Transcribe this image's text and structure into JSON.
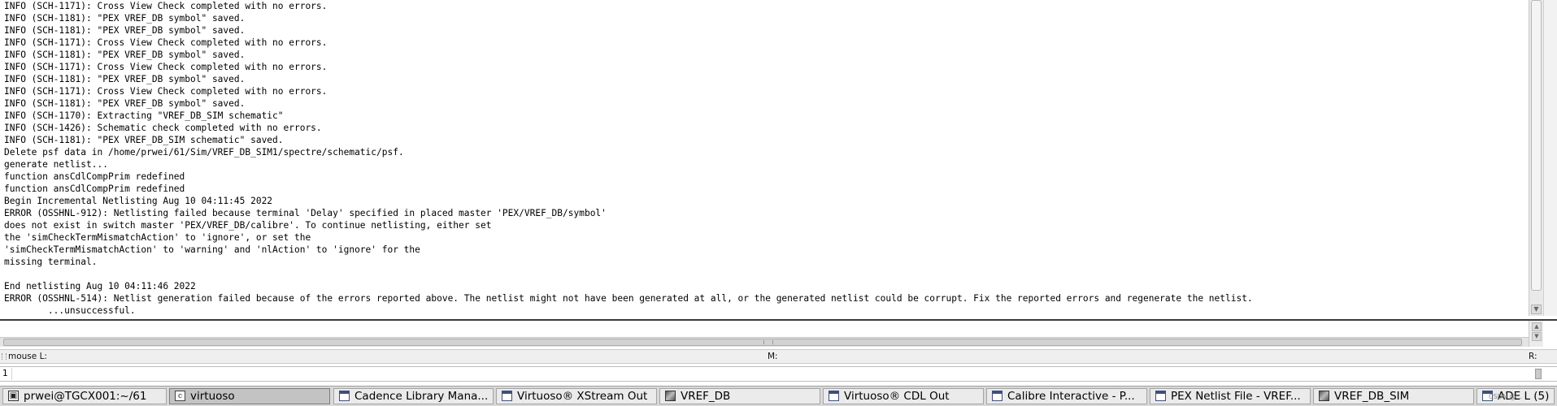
{
  "log": {
    "lines": [
      "INFO (SCH-1171): Cross View Check completed with no errors.",
      "INFO (SCH-1181): \"PEX VREF_DB symbol\" saved.",
      "INFO (SCH-1181): \"PEX VREF_DB symbol\" saved.",
      "INFO (SCH-1171): Cross View Check completed with no errors.",
      "INFO (SCH-1181): \"PEX VREF_DB symbol\" saved.",
      "INFO (SCH-1171): Cross View Check completed with no errors.",
      "INFO (SCH-1181): \"PEX VREF_DB symbol\" saved.",
      "INFO (SCH-1171): Cross View Check completed with no errors.",
      "INFO (SCH-1181): \"PEX VREF_DB symbol\" saved.",
      "INFO (SCH-1170): Extracting \"VREF_DB_SIM schematic\"",
      "INFO (SCH-1426): Schematic check completed with no errors.",
      "INFO (SCH-1181): \"PEX VREF_DB_SIM schematic\" saved.",
      "Delete psf data in /home/prwei/61/Sim/VREF_DB_SIM1/spectre/schematic/psf.",
      "generate netlist...",
      "function ansCdlCompPrim redefined",
      "function ansCdlCompPrim redefined",
      "Begin Incremental Netlisting Aug 10 04:11:45 2022",
      "ERROR (OSSHNL-912): Netlisting failed because terminal 'Delay' specified in placed master 'PEX/VREF_DB/symbol'",
      "does not exist in switch master 'PEX/VREF_DB/calibre'. To continue netlisting, either set",
      "the 'simCheckTermMismatchAction' to 'ignore', or set the",
      "'simCheckTermMismatchAction' to 'warning' and 'nlAction' to 'ignore' for the",
      "missing terminal.",
      "",
      "End netlisting Aug 10 04:11:46 2022",
      "ERROR (OSSHNL-514): Netlist generation failed because of the errors reported above. The netlist might not have been generated at all, or the generated netlist could be corrupt. Fix the reported errors and regenerate the netlist.",
      "        ...unsuccessful."
    ]
  },
  "status": {
    "mouse_left": "mouse L:",
    "mouse_middle": "M:",
    "mouse_right": "R:"
  },
  "prompt": {
    "number": "1",
    "value": ""
  },
  "taskbar": {
    "items": [
      {
        "label": "prwei@TGCX001:~/61",
        "icon": "terminal-icon"
      },
      {
        "label": "virtuoso",
        "icon": "virtuoso-icon"
      },
      {
        "label": "Cadence Library Mana...",
        "icon": "window-icon"
      },
      {
        "label": "Virtuoso® XStream Out",
        "icon": "window-icon"
      },
      {
        "label": "VREF_DB",
        "icon": "layout-icon"
      },
      {
        "label": "Virtuoso® CDL Out",
        "icon": "window-icon"
      },
      {
        "label": "Calibre Interactive - P...",
        "icon": "window-icon"
      },
      {
        "label": "PEX Netlist File - VREF...",
        "icon": "window-icon"
      },
      {
        "label": "VREF_DB_SIM",
        "icon": "layout-icon"
      },
      {
        "label": "ADE L (5)",
        "icon": "window-icon"
      }
    ],
    "tray_text": "CSDN @..."
  }
}
